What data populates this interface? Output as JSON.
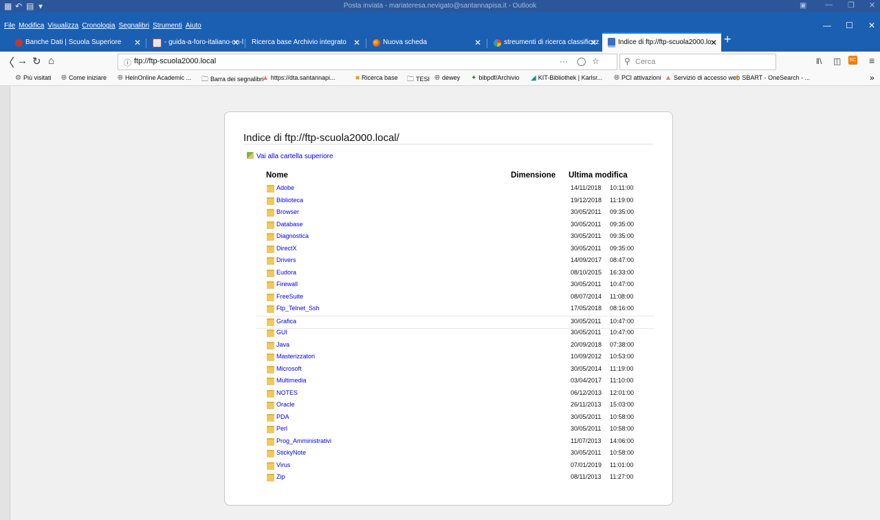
{
  "outlook": {
    "title": "Posta inviata - mariateresa.nevigato@santannapisa.it - Outlook"
  },
  "menubar": {
    "items": [
      "File",
      "Modifica",
      "Visualizza",
      "Cronologia",
      "Segnalibri",
      "Strumenti",
      "Aiuto"
    ]
  },
  "tabs": [
    {
      "label": "Banche Dati | Scuola Superiore",
      "icon": "red-logo-icon",
      "active": false
    },
    {
      "label": "- guida-a-foro-italiano-on-line",
      "icon": "document-icon",
      "active": false
    },
    {
      "label": "Ricerca base Archivio integrato",
      "icon": "",
      "active": false
    },
    {
      "label": "Nuova scheda",
      "icon": "firefox-icon",
      "active": false
    },
    {
      "label": "streumenti di ricerca classificaz",
      "icon": "google-icon",
      "active": false
    },
    {
      "label": "Indice di ftp://ftp-scuola2000.lo",
      "icon": "ftp-icon",
      "active": true
    }
  ],
  "navbar": {
    "url": "ftp://ftp-scuola2000.local",
    "search_placeholder": "Cerca",
    "page_actions": "···"
  },
  "bookmarks": [
    {
      "label": "Più visitati",
      "icon": "gear-icon"
    },
    {
      "label": "Come iniziare",
      "icon": "globe-icon"
    },
    {
      "label": "HeinOnline Academic ...",
      "icon": "globe-icon"
    },
    {
      "label": "Barra dei segnalibri",
      "icon": "folder-icon"
    },
    {
      "label": "https://dta.santannapi...",
      "icon": "red-logo-icon"
    },
    {
      "label": "Ricerca base",
      "icon": "books-icon"
    },
    {
      "label": "TESI",
      "icon": "folder-icon"
    },
    {
      "label": "dewey",
      "icon": "globe-icon"
    },
    {
      "label": "bibpdf/Archivio",
      "icon": "star-icon"
    },
    {
      "label": "KIT-Bibliothek | Karlsr...",
      "icon": "kit-icon"
    },
    {
      "label": "PCI attivazioni",
      "icon": "globe-icon"
    },
    {
      "label": "Servizio di accesso web",
      "icon": "red-logo-icon"
    },
    {
      "label": "SBART - OneSearch - ...",
      "icon": "rainbow-icon"
    }
  ],
  "listing": {
    "title": "Indice di ftp://ftp-scuola2000.local/",
    "up_link": "Vai alla cartella superiore",
    "columns": {
      "name": "Nome",
      "size": "Dimensione",
      "modified": "Ultima modifica"
    },
    "rows": [
      {
        "name": "Adobe",
        "date": "14/11/2018",
        "time": "10:11:00"
      },
      {
        "name": "Biblioteca",
        "date": "19/12/2018",
        "time": "11:19:00"
      },
      {
        "name": "Browser",
        "date": "30/05/2011",
        "time": "09:35:00"
      },
      {
        "name": "Database",
        "date": "30/05/2011",
        "time": "09:35:00"
      },
      {
        "name": "Diagnostica",
        "date": "30/05/2011",
        "time": "09:35:00"
      },
      {
        "name": "DirectX",
        "date": "30/05/2011",
        "time": "09:35:00"
      },
      {
        "name": "Drivers",
        "date": "14/09/2017",
        "time": "08:47:00"
      },
      {
        "name": "Eudora",
        "date": "08/10/2015",
        "time": "16:33:00"
      },
      {
        "name": "Firewall",
        "date": "30/05/2011",
        "time": "10:47:00"
      },
      {
        "name": "FreeSuite",
        "date": "08/07/2014",
        "time": "11:08:00"
      },
      {
        "name": "Ftp_Telnet_Ssh",
        "date": "17/05/2018",
        "time": "08:16:00"
      },
      {
        "name": "Grafica",
        "date": "30/05/2011",
        "time": "10:47:00"
      },
      {
        "name": "GUI",
        "date": "30/05/2011",
        "time": "10:47:00"
      },
      {
        "name": "Java",
        "date": "20/09/2018",
        "time": "07:38:00"
      },
      {
        "name": "Masterizzatori",
        "date": "10/09/2012",
        "time": "10:53:00"
      },
      {
        "name": "Microsoft",
        "date": "30/05/2014",
        "time": "11:19:00"
      },
      {
        "name": "Multimedia",
        "date": "03/04/2017",
        "time": "11:10:00"
      },
      {
        "name": "NOTES",
        "date": "06/12/2013",
        "time": "12:01:00"
      },
      {
        "name": "Oracle",
        "date": "26/11/2013",
        "time": "15:03:00"
      },
      {
        "name": "PDA",
        "date": "30/05/2011",
        "time": "10:58:00"
      },
      {
        "name": "Perl",
        "date": "30/05/2011",
        "time": "10:58:00"
      },
      {
        "name": "Prog_Amministrativi",
        "date": "11/07/2013",
        "time": "14:06:00"
      },
      {
        "name": "StickyNote",
        "date": "30/05/2011",
        "time": "10:58:00"
      },
      {
        "name": "Virus",
        "date": "07/01/2019",
        "time": "11:01:00"
      },
      {
        "name": "Zip",
        "date": "08/11/2013",
        "time": "11:27:00"
      }
    ],
    "highlighted_row": "Grafica"
  }
}
